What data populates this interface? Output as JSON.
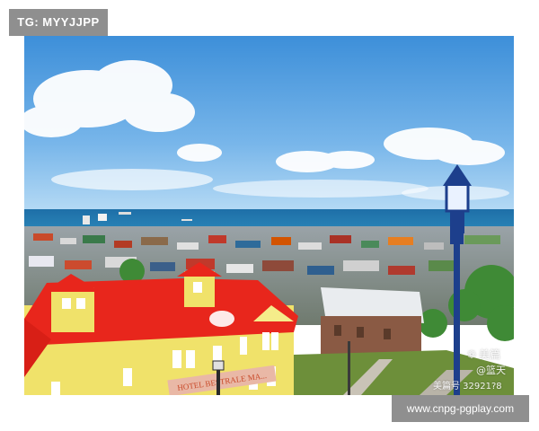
{
  "header": {
    "tag": "TG: MYYJJPP"
  },
  "footer": {
    "url": "www.cnpg-pgplay.com"
  },
  "watermark": {
    "brand_icon": "brand-logo-icon",
    "brand": "美篇",
    "author": "@篮天",
    "id": "美篇号 32921?8"
  },
  "sign": {
    "building_text": "HOTEL BESTRALE MA..."
  },
  "colors": {
    "sky_top": "#3d8fd9",
    "sea": "#1e6fa8",
    "roof_red": "#e8261c",
    "facade_yellow": "#f0e26a",
    "lamp_blue": "#1d3f8c"
  }
}
